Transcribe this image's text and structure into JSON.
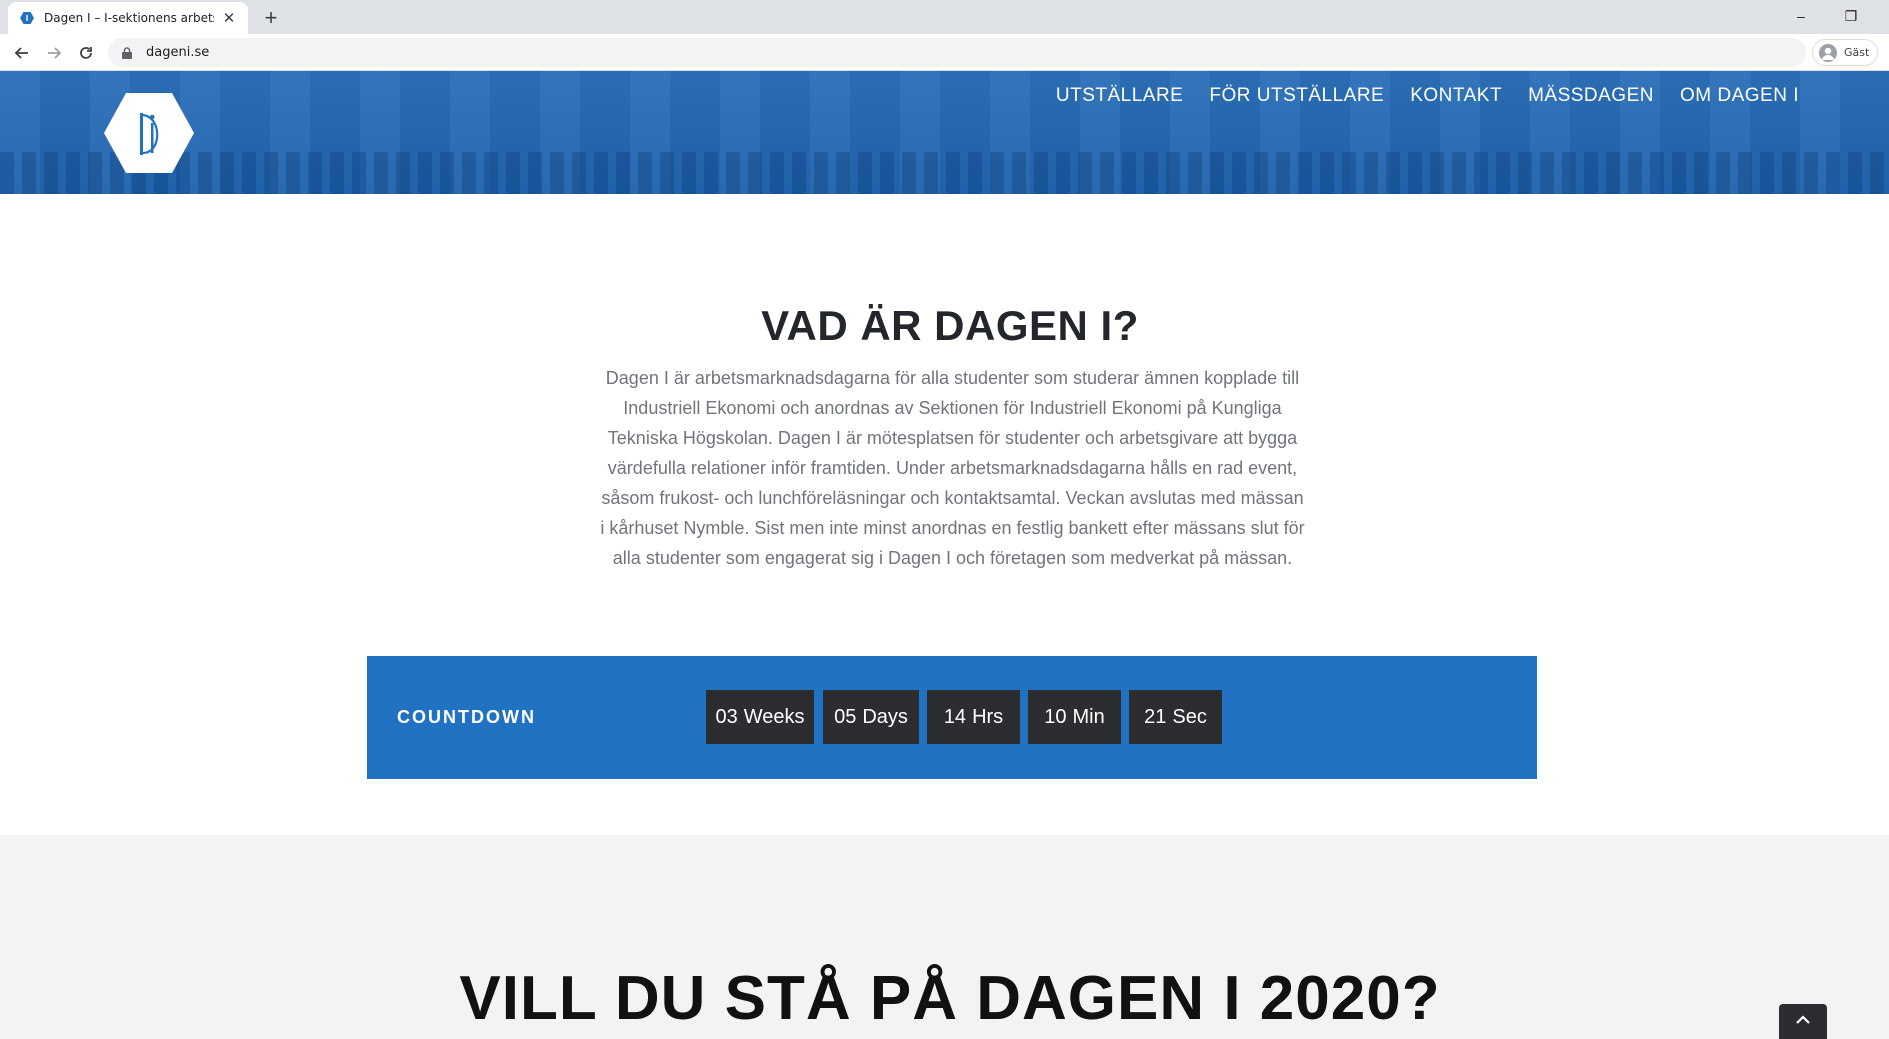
{
  "browser": {
    "tab_title": "Dagen I – I-sektionens arbetsmarknadsdagar",
    "tab_close": "✕",
    "new_tab": "+",
    "url": "dageni.se",
    "profile_label": "Gäst",
    "minimize": "–",
    "restore": "❐"
  },
  "site": {
    "logo_icon": "dagen-i-hexagon-logo",
    "nav": [
      {
        "label": "UTSTÄLLARE"
      },
      {
        "label": "FÖR UTSTÄLLARE"
      },
      {
        "label": "KONTAKT"
      },
      {
        "label": "MÄSSDAGEN"
      },
      {
        "label": "OM DAGEN I"
      }
    ],
    "brand_color": "#2272c3"
  },
  "about": {
    "title": "VAD ÄR DAGEN I?",
    "lines": [
      "Dagen I är arbetsmarknadsdagarna för alla studenter som studerar ämnen kopplade till",
      "Industriell Ekonomi och anordnas av Sektionen för Industriell Ekonomi på Kungliga",
      "Tekniska Högskolan. Dagen I är mötesplatsen för studenter och arbetsgivare att bygga",
      "värdefulla relationer inför framtiden. Under arbetsmarknadsdagarna hålls en rad event,",
      "såsom frukost- och lunchföreläsningar och kontaktsamtal. Veckan avslutas med mässan",
      "i kårhuset Nymble. Sist men inte minst anordnas en festlig bankett efter mässans slut för",
      "alla studenter som engagerat sig i Dagen I och företagen som medverkat på mässan."
    ]
  },
  "countdown": {
    "heading": "COUNTDOWN",
    "units": [
      {
        "num": "03",
        "unit": "Weeks"
      },
      {
        "num": "05",
        "unit": "Days"
      },
      {
        "num": "14",
        "unit": "Hrs"
      },
      {
        "num": "10",
        "unit": "Min"
      },
      {
        "num": "21",
        "unit": "Sec"
      }
    ]
  },
  "next": {
    "title": "VILL DU STÅ PÅ DAGEN I 2020?"
  },
  "to_top_icon": "chevron-up-icon"
}
